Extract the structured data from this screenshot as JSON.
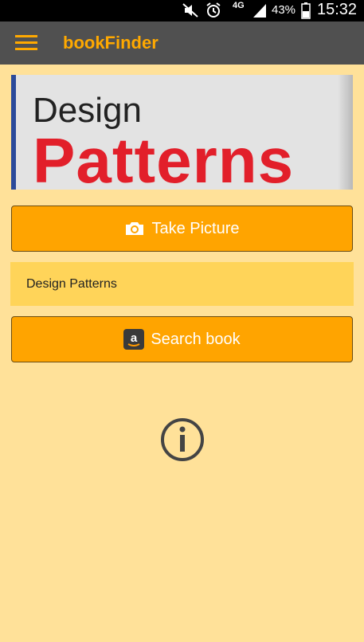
{
  "status_bar": {
    "network": "4G",
    "battery": "43%",
    "time": "15:32"
  },
  "app_bar": {
    "title": "bookFinder",
    "accent_color": "#ffa900"
  },
  "book_image": {
    "line1": "Design",
    "line2": "Patterns"
  },
  "actions": {
    "take_picture_label": "Take Picture",
    "search_label": "Search book"
  },
  "result": {
    "value": "Design Patterns"
  },
  "icons": [
    "menu-icon",
    "camera-icon",
    "amazon-icon",
    "info-icon"
  ],
  "colors": {
    "background": "#ffe199",
    "button": "#ffa400",
    "field": "#ffd459",
    "app_bar": "#505050"
  }
}
